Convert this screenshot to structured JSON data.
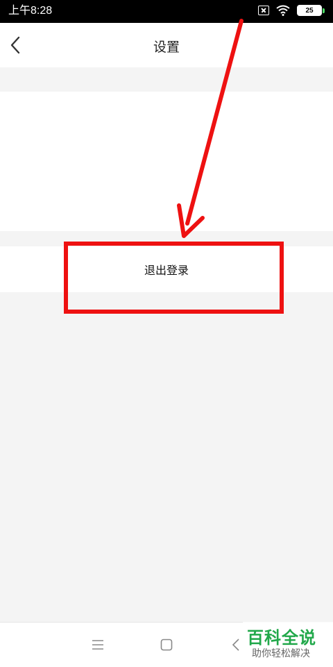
{
  "status_bar": {
    "time": "上午8:28",
    "battery_level": "25",
    "icons": [
      "sim-off-icon",
      "wifi-icon",
      "battery-icon"
    ]
  },
  "header": {
    "back_icon": "chevron-left-icon",
    "title": "设置"
  },
  "logout": {
    "label": "退出登录"
  },
  "annotation": {
    "color": "#ee1111",
    "shapes": [
      "arrow",
      "highlight-rectangle"
    ]
  },
  "nav_bar": {
    "icons": [
      "menu-icon",
      "home-icon",
      "back-icon"
    ]
  },
  "watermark": {
    "main": "百科全说",
    "sub": "助你轻松解决",
    "color": "#21a84a"
  }
}
